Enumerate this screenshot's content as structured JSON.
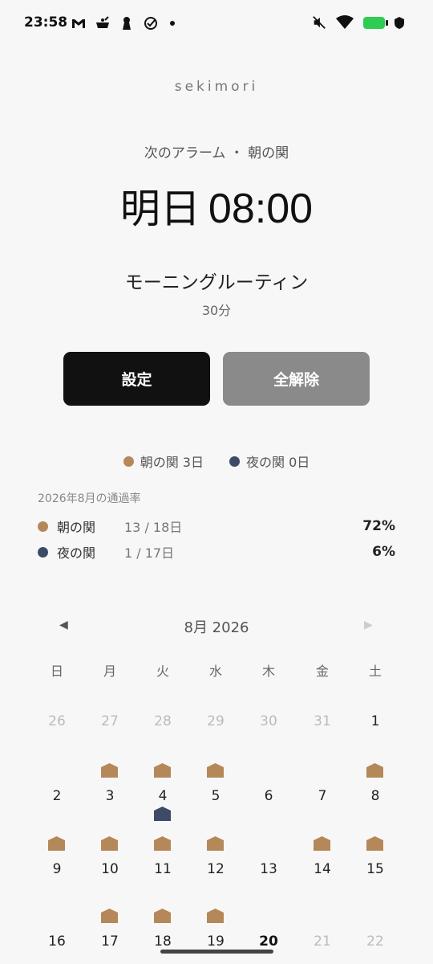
{
  "status_bar": {
    "time": "23:58",
    "left_icons": [
      "gmail-icon",
      "cooking-pot-icon",
      "keyhole-icon",
      "check-circle-icon",
      "dot-icon"
    ],
    "right_icons": [
      "mute-icon",
      "wifi-icon",
      "battery-icon",
      "shield-icon"
    ],
    "battery_color": "#2ecc52"
  },
  "app": {
    "brand": "sekimori",
    "next_alarm_label": "次のアラーム ・ 朝の関",
    "alarm_day": "明日",
    "alarm_time": "08:00",
    "routine_name": "モーニングルーティン",
    "routine_duration": "30分"
  },
  "buttons": {
    "set_label": "設定",
    "clear_label": "全解除"
  },
  "legend": [
    {
      "label": "朝の関 3日",
      "color": "#b58859"
    },
    {
      "label": "夜の関 0日",
      "color": "#3d4b66"
    }
  ],
  "stats": {
    "title": "2026年8月の通過率",
    "rows": [
      {
        "label": "朝の関",
        "count": "13 / 18日",
        "rate": "72%",
        "color": "#b58859"
      },
      {
        "label": "夜の関",
        "count": "1 / 17日",
        "rate": "6%",
        "color": "#3d4b66"
      }
    ]
  },
  "calendar": {
    "title": "8月 2026",
    "prev_icon": "triangle-left-icon",
    "next_icon": "triangle-right-icon",
    "weekdays": [
      "日",
      "月",
      "火",
      "水",
      "木",
      "金",
      "土"
    ],
    "weeks": [
      [
        {
          "d": "26",
          "other": true
        },
        {
          "d": "27",
          "other": true
        },
        {
          "d": "28",
          "other": true
        },
        {
          "d": "29",
          "other": true
        },
        {
          "d": "30",
          "other": true
        },
        {
          "d": "31",
          "other": true
        },
        {
          "d": "1"
        }
      ],
      [
        {
          "d": "2"
        },
        {
          "d": "3",
          "morning": true
        },
        {
          "d": "4",
          "morning": true,
          "night": true
        },
        {
          "d": "5",
          "morning": true
        },
        {
          "d": "6"
        },
        {
          "d": "7"
        },
        {
          "d": "8",
          "morning": true
        }
      ],
      [
        {
          "d": "9",
          "morning": true
        },
        {
          "d": "10",
          "morning": true
        },
        {
          "d": "11",
          "morning": true
        },
        {
          "d": "12",
          "morning": true
        },
        {
          "d": "13"
        },
        {
          "d": "14",
          "morning": true
        },
        {
          "d": "15",
          "morning": true
        }
      ],
      [
        {
          "d": "16"
        },
        {
          "d": "17",
          "morning": true
        },
        {
          "d": "18",
          "morning": true
        },
        {
          "d": "19",
          "morning": true
        },
        {
          "d": "20",
          "today": true
        },
        {
          "d": "21",
          "other": true
        },
        {
          "d": "22",
          "other": true
        }
      ]
    ],
    "morning_color": "#b58859",
    "night_color": "#3d4b66"
  }
}
